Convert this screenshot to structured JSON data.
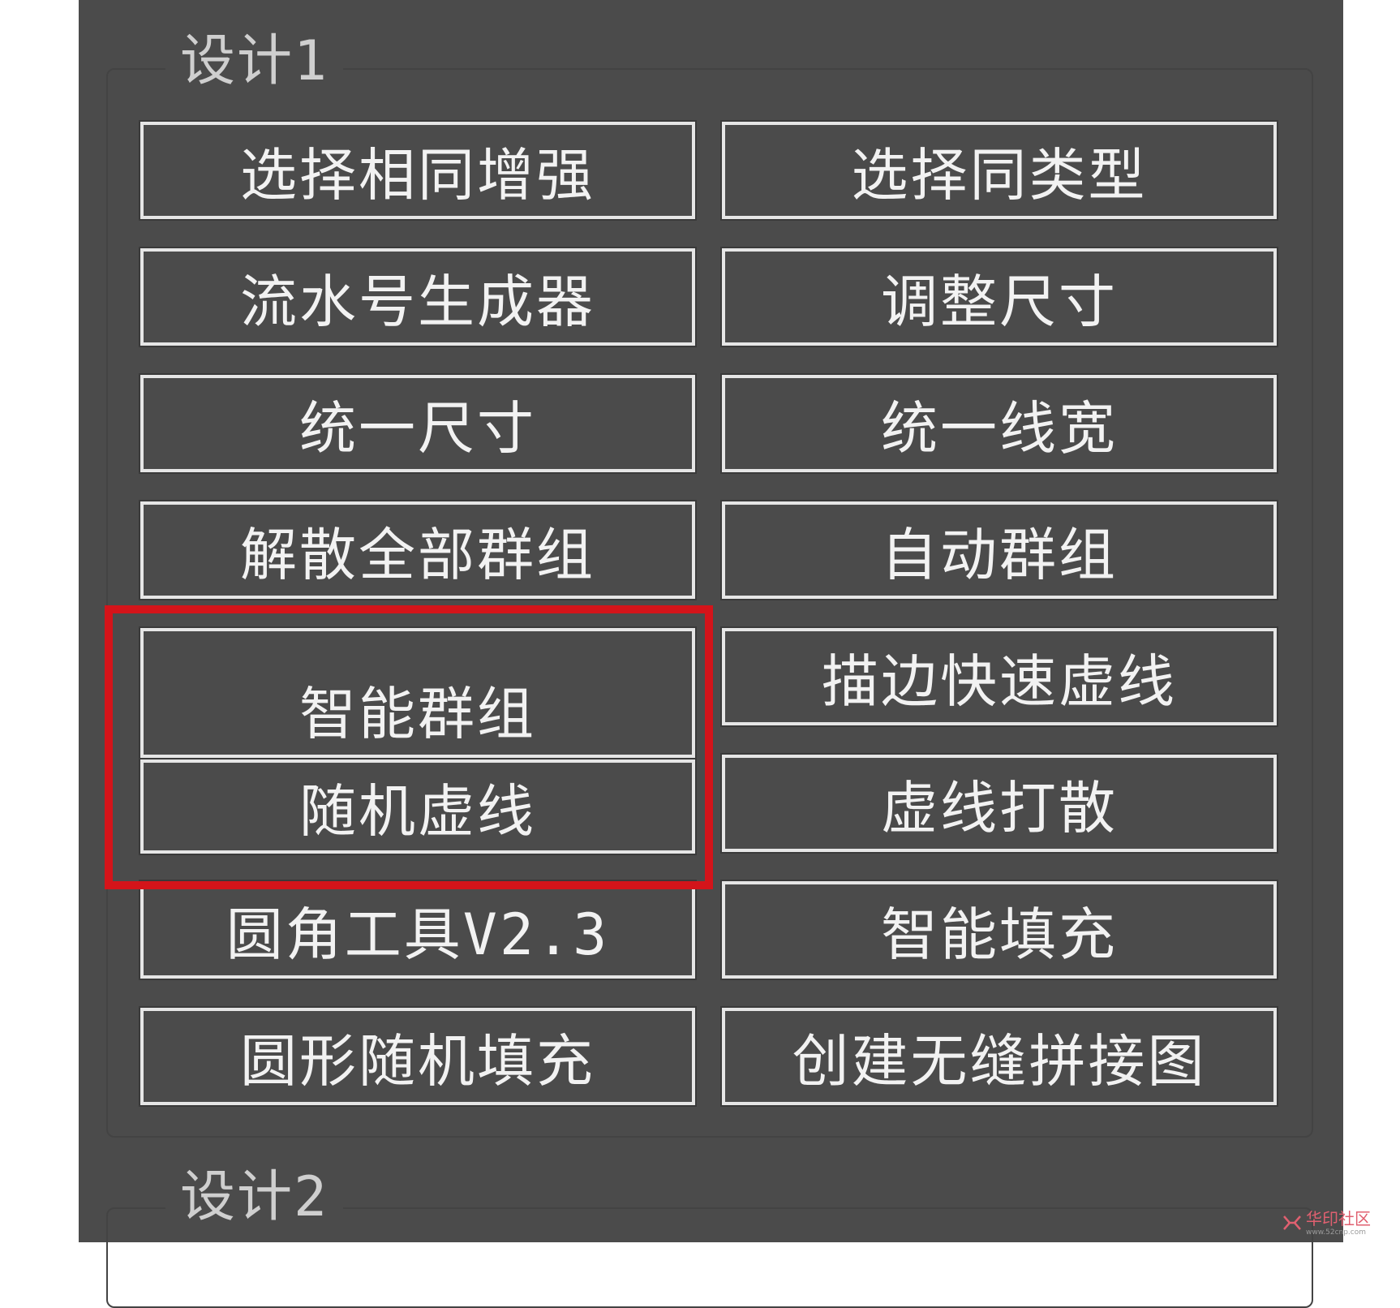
{
  "groups": [
    {
      "title": "设计1",
      "buttons": [
        {
          "left": "选择相同增强",
          "right": "选择同类型"
        },
        {
          "left": "流水号生成器",
          "right": "调整尺寸"
        },
        {
          "left": "统一尺寸",
          "right": "统一线宽"
        },
        {
          "left": "解散全部群组",
          "right": "自动群组"
        },
        {
          "left": "智能群组",
          "right": "描边快速虚线"
        },
        {
          "left": "随机虚线",
          "right": "虚线打散"
        },
        {
          "left": "圆角工具V2.3",
          "right": "智能填充"
        },
        {
          "left": "圆形随机填充",
          "right": "创建无缝拼接图"
        }
      ]
    },
    {
      "title": "设计2"
    }
  ],
  "watermark": {
    "main": "华印社区",
    "sub": "www.52cnp.com"
  },
  "colors": {
    "panel_bg": "#4b4b4b",
    "button_border": "#e6e6e6",
    "text": "#f2f2f2",
    "highlight": "#d4141a"
  }
}
